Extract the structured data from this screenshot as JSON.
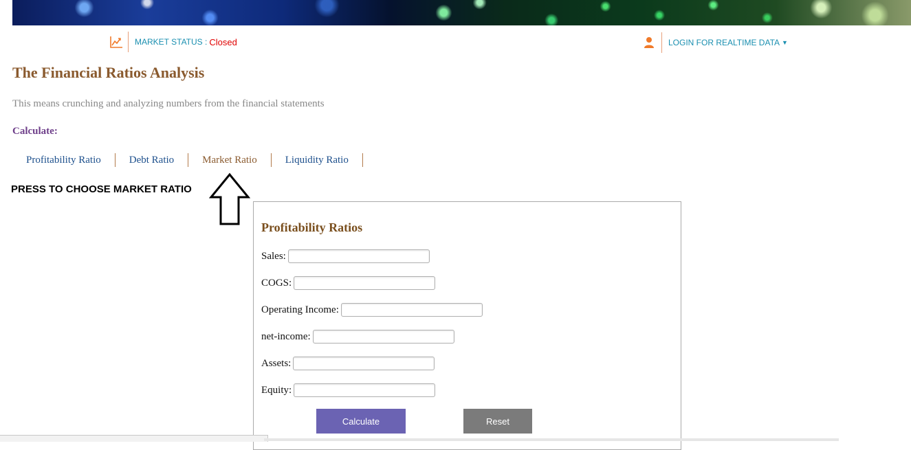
{
  "header": {
    "market_status_label": "MARKET STATUS :",
    "market_status_value": "Closed",
    "login_label": "LOGIN FOR REALTIME DATA",
    "icons": {
      "market": "line-chart-icon",
      "login": "user-icon",
      "caret": "caret-down-icon"
    },
    "colors": {
      "link": "#1a8fb0",
      "closed": "#e00000",
      "icon": "#f07a2a"
    }
  },
  "page": {
    "title": "The Financial Ratios Analysis",
    "subtitle": "This means crunching and analyzing numbers from the financial statements",
    "calculate_label": "Calculate:"
  },
  "tabs": [
    {
      "label": "Profitability Ratio"
    },
    {
      "label": "Debt Ratio"
    },
    {
      "label": "Market Ratio",
      "active": true
    },
    {
      "label": "Liquidity Ratio"
    }
  ],
  "annotation": {
    "text": "PRESS TO CHOOSE MARKET RATIO",
    "icon": "up-arrow-icon"
  },
  "form": {
    "title": "Profitability Ratios",
    "fields": [
      {
        "label": "Sales:",
        "value": ""
      },
      {
        "label": "COGS:",
        "value": ""
      },
      {
        "label": "Operating Income:",
        "value": ""
      },
      {
        "label": "net-income:",
        "value": ""
      },
      {
        "label": "Assets:",
        "value": ""
      },
      {
        "label": "Equity:",
        "value": ""
      }
    ],
    "calculate_button": "Calculate",
    "reset_button": "Reset",
    "colors": {
      "calculate": "#6b63b3",
      "reset": "#7b7b7b"
    }
  }
}
